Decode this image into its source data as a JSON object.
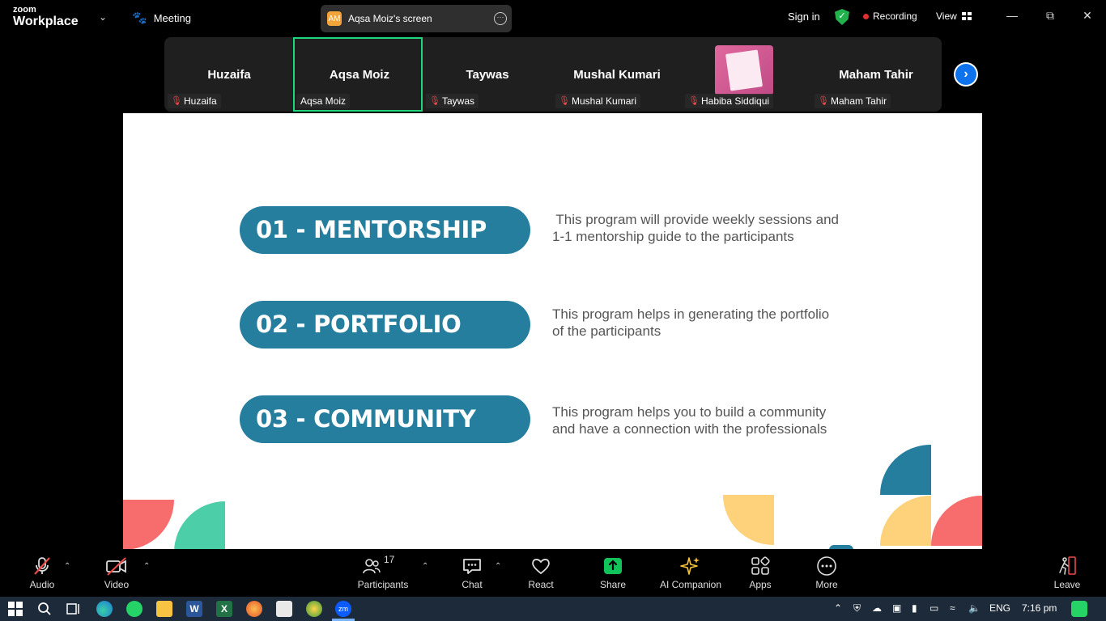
{
  "app": {
    "logo_small": "zoom",
    "logo_big": "Workplace",
    "meeting_label": "Meeting"
  },
  "screen_share": {
    "initials": "AM",
    "title": "Aqsa Moiz's screen"
  },
  "header": {
    "signin": "Sign in",
    "recording": "Recording",
    "view": "View"
  },
  "participants": [
    {
      "name": "Huzaifa",
      "label": "Huzaifa",
      "muted": true
    },
    {
      "name": "Aqsa Moiz",
      "label": "Aqsa Moiz",
      "muted": false,
      "active": true
    },
    {
      "name": "Taywas",
      "label": "Taywas",
      "muted": true
    },
    {
      "name": "Mushal Kumari",
      "label": "Mushal Kumari",
      "muted": true
    },
    {
      "name": "",
      "label": "Habiba Siddiqui",
      "muted": true,
      "has_image": true
    },
    {
      "name": "Maham Tahir",
      "label": "Maham Tahir",
      "muted": true
    }
  ],
  "slide": {
    "items": [
      {
        "title": "01 - MENTORSHIP",
        "desc_line1": " This program will provide weekly sessions and",
        "desc_line2": "1-1 mentorship guide to the participants"
      },
      {
        "title": "02 - PORTFOLIO",
        "desc_line1": "This program helps in generating the portfolio",
        "desc_line2": "of the participants"
      },
      {
        "title": "03 - COMMUNITY",
        "desc_line1": "This program helps you to build a community",
        "desc_line2": "and have a connection with the professionals"
      }
    ],
    "colors": {
      "pill": "#257e9e",
      "coral": "#f76d6d",
      "teal": "#4ccfa9",
      "yellow": "#fdd27a",
      "blue": "#257e9e"
    }
  },
  "toolbar": {
    "audio": "Audio",
    "video": "Video",
    "participants": "Participants",
    "participants_count": "17",
    "chat": "Chat",
    "react": "React",
    "share": "Share",
    "ai": "AI Companion",
    "apps": "Apps",
    "more": "More",
    "leave": "Leave"
  },
  "taskbar": {
    "lang": "ENG",
    "time": "7:16 pm"
  }
}
